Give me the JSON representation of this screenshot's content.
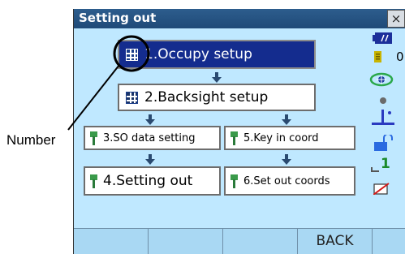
{
  "annotation": {
    "label": "Number"
  },
  "window": {
    "title": "Setting out",
    "close_glyph": "×"
  },
  "menu": {
    "items": [
      {
        "number": "1.",
        "label": "Occupy setup",
        "full": "1.Occupy setup",
        "selected": true
      },
      {
        "label": "2.Backsight setup"
      },
      {
        "label": "3.SO data setting"
      },
      {
        "label": "5.Key in coord"
      },
      {
        "label": "4.Setting out"
      },
      {
        "label": "6.Set out coords"
      }
    ]
  },
  "status_icons": {
    "battery": "battery-icon",
    "memory_value": "0",
    "memory_icon": "memory-icon",
    "target": "target-icon",
    "dot": "dot-icon",
    "tilt": "tilt-icon",
    "lock": "lock-icon",
    "count_value": "1",
    "count_icon": "level-icon",
    "comms": "comms-icon"
  },
  "function_keys": [
    "",
    "",
    "",
    "BACK",
    ""
  ],
  "colors": {
    "screen_bg": "#bfe8ff",
    "title_bar": "#1f4a78",
    "selected_box": "#142c8e",
    "fkey_bg": "#a9d8f3"
  }
}
